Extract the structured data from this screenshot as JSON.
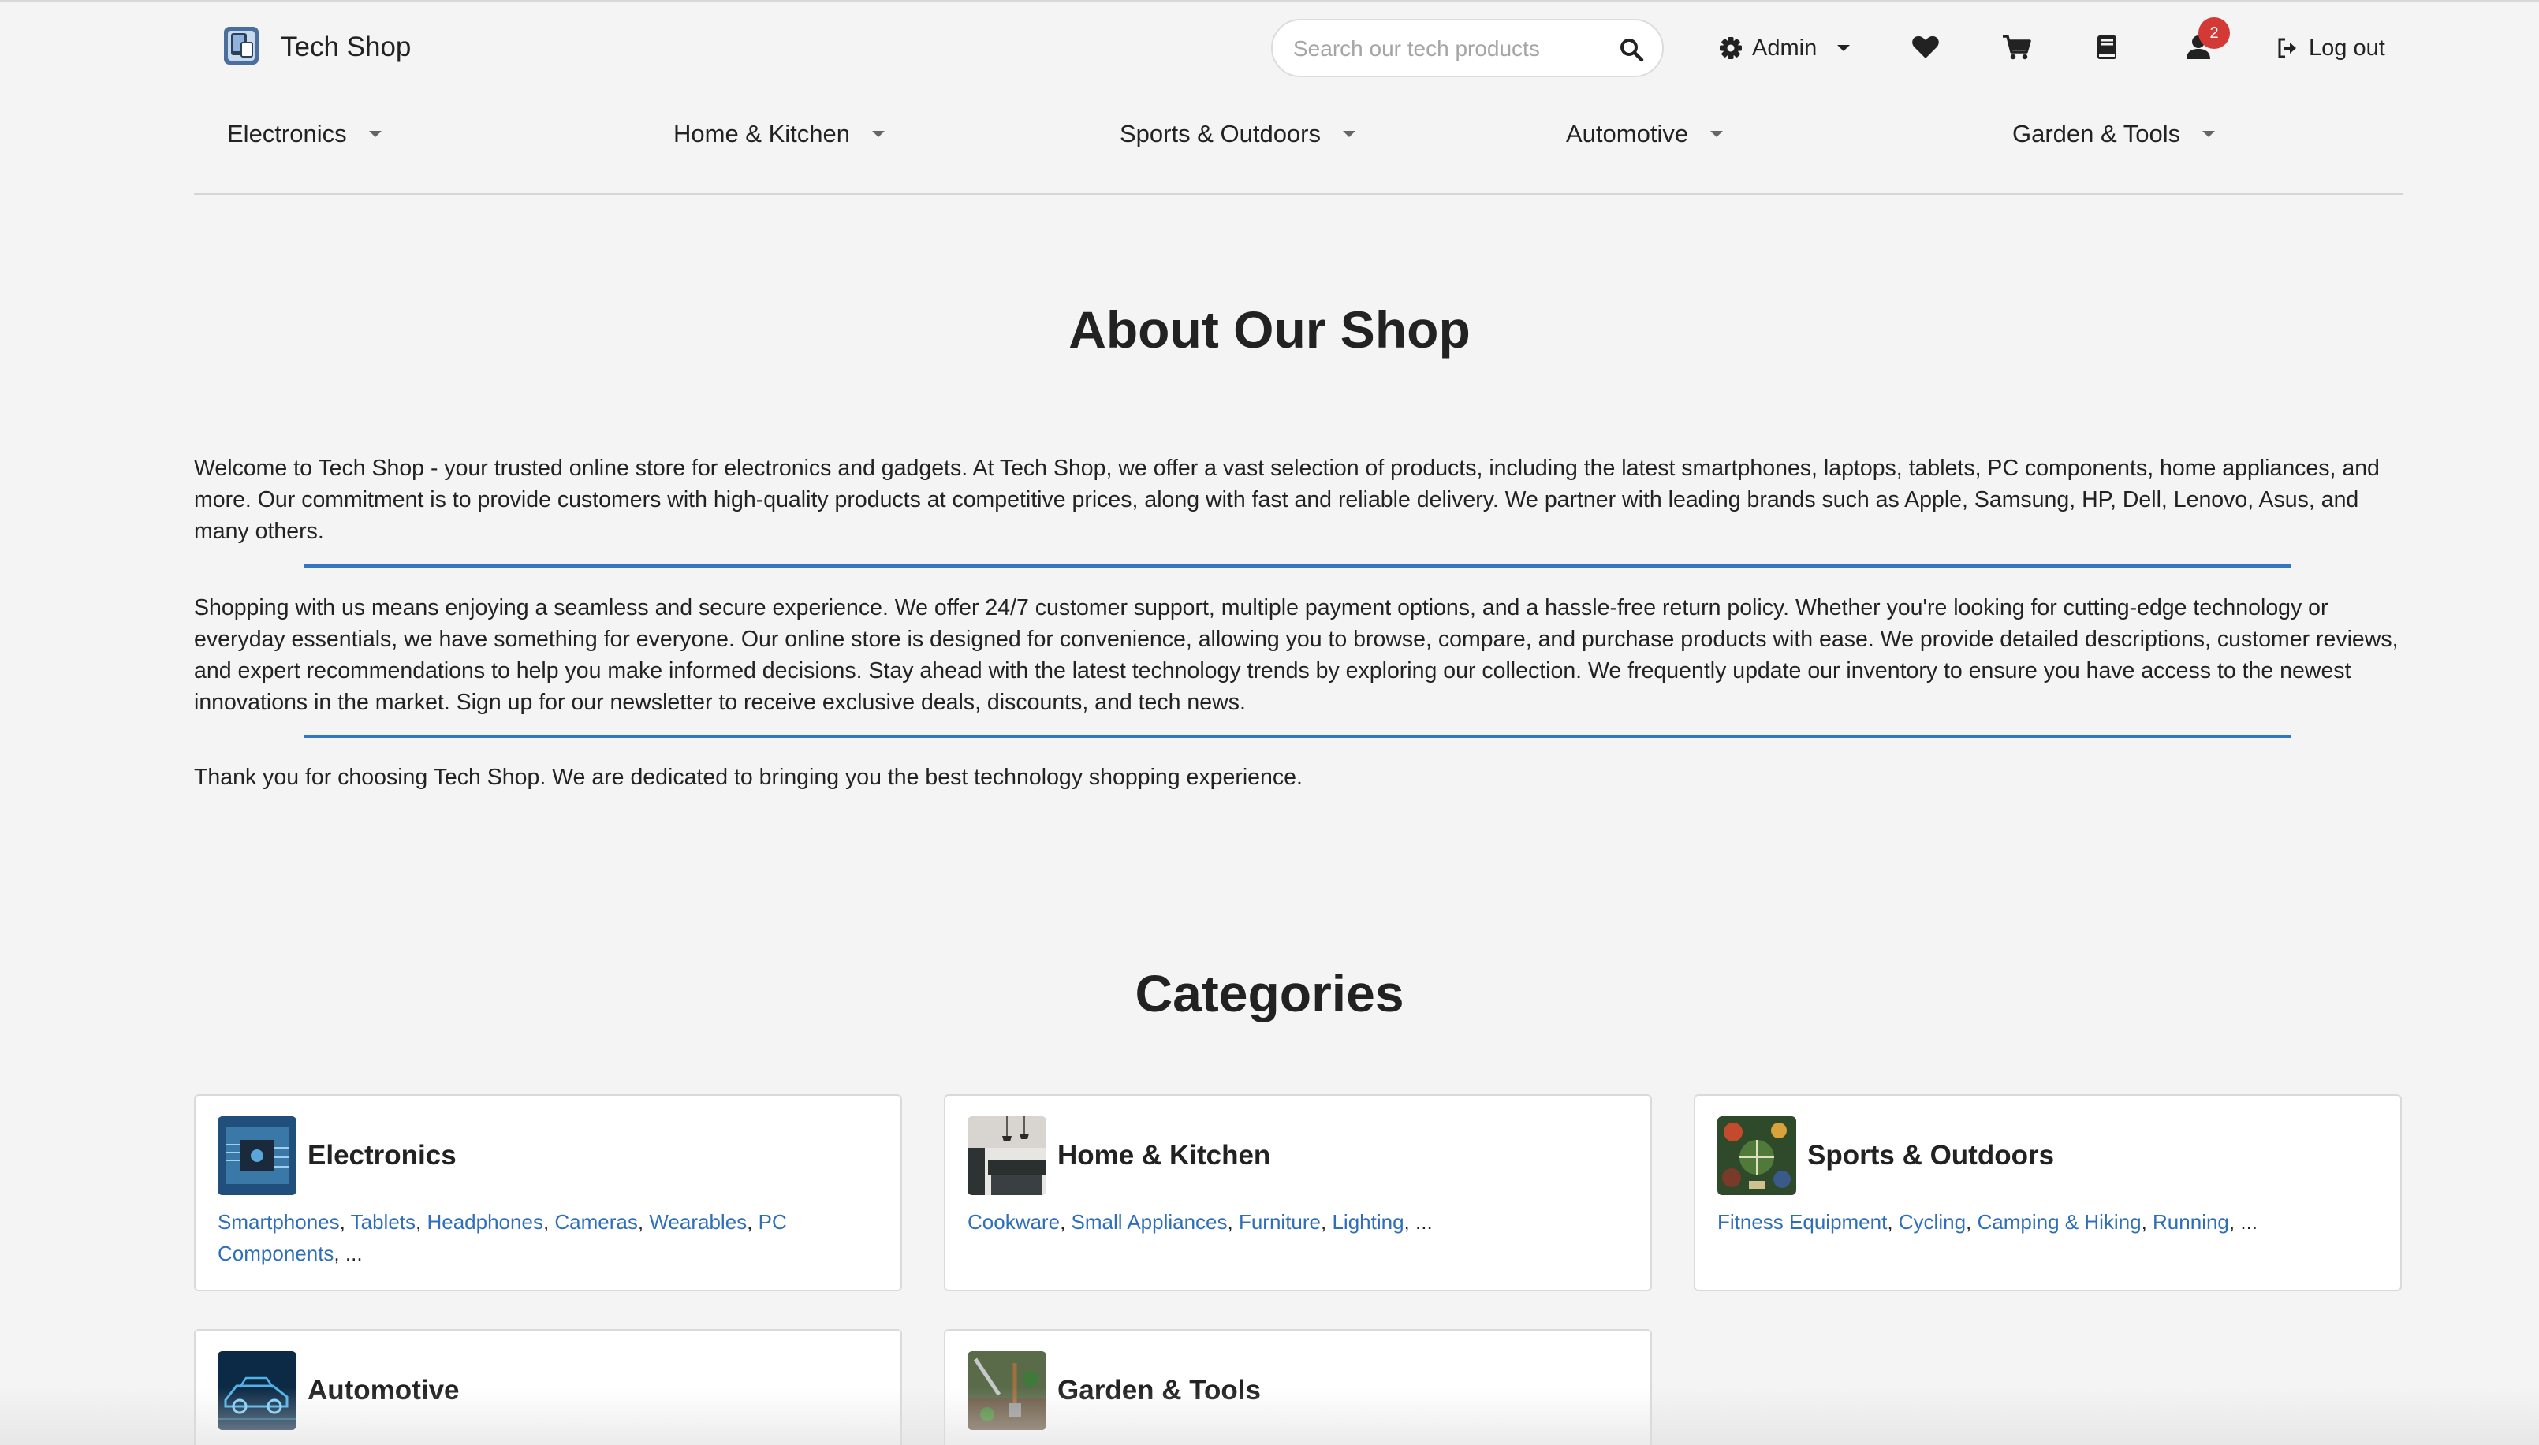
{
  "header": {
    "brand": "Tech Shop",
    "search": {
      "placeholder": "Search our tech products",
      "value": ""
    },
    "admin_label": "Admin",
    "notification_count": "2",
    "logout_label": "Log out"
  },
  "nav": {
    "items": [
      {
        "label": "Electronics"
      },
      {
        "label": "Home & Kitchen"
      },
      {
        "label": "Sports & Outdoors"
      },
      {
        "label": "Automotive"
      },
      {
        "label": "Garden & Tools"
      }
    ]
  },
  "about": {
    "title": "About Our Shop",
    "paragraphs": [
      "Welcome to Tech Shop - your trusted online store for electronics and gadgets. At Tech Shop, we offer a vast selection of products, including the latest smartphones, laptops, tablets, PC components, home appliances, and more. Our commitment is to provide customers with high-quality products at competitive prices, along with fast and reliable delivery. We partner with leading brands such as Apple, Samsung, HP, Dell, Lenovo, Asus, and many others.",
      "Shopping with us means enjoying a seamless and secure experience. We offer 24/7 customer support, multiple payment options, and a hassle-free return policy. Whether you're looking for cutting-edge technology or everyday essentials, we have something for everyone. Our online store is designed for convenience, allowing you to browse, compare, and purchase products with ease. We provide detailed descriptions, customer reviews, and expert recommendations to help you make informed decisions. Stay ahead with the latest technology trends by exploring our collection. We frequently update our inventory to ensure you have access to the newest innovations in the market. Sign up for our newsletter to receive exclusive deals, discounts, and tech news.",
      "Thank you for choosing Tech Shop. We are dedicated to bringing you the best technology shopping experience."
    ]
  },
  "categories": {
    "title": "Categories",
    "cards": [
      {
        "name": "Electronics",
        "links": [
          "Smartphones",
          "Tablets",
          "Headphones",
          "Cameras",
          "Wearables",
          "PC Components"
        ],
        "more": "..."
      },
      {
        "name": "Home & Kitchen",
        "links": [
          "Cookware",
          "Small Appliances",
          "Furniture",
          "Lighting"
        ],
        "more": "..."
      },
      {
        "name": "Sports & Outdoors",
        "links": [
          "Fitness Equipment",
          "Cycling",
          "Camping & Hiking",
          "Running"
        ],
        "more": "..."
      },
      {
        "name": "Automotive"
      },
      {
        "name": "Garden & Tools"
      }
    ]
  },
  "colors": {
    "background": "#f4f4f4",
    "link": "#2f6fba",
    "divider_blue": "#3377c2",
    "badge": "#d33a35"
  }
}
